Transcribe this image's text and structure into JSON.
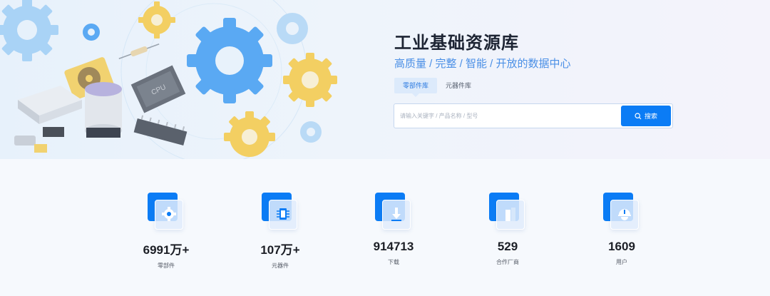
{
  "hero": {
    "title": "工业基础资源库",
    "subtitle": "高质量 / 完整 / 智能 / 开放的数据中心"
  },
  "tabs": [
    {
      "label": "零部件库",
      "active": true
    },
    {
      "label": "元器件库",
      "active": false
    }
  ],
  "search": {
    "placeholder": "请输入关键字 / 产品名称 / 型号",
    "button_label": "搜索",
    "button_icon": "search-icon"
  },
  "stats": [
    {
      "value": "6991万+",
      "label": "零部件",
      "icon": "gear-icon"
    },
    {
      "value": "107万+",
      "label": "元器件",
      "icon": "chip-icon"
    },
    {
      "value": "914713",
      "label": "下载",
      "icon": "download-icon"
    },
    {
      "value": "529",
      "label": "合作厂商",
      "icon": "building-icon"
    },
    {
      "value": "1609",
      "label": "用户",
      "icon": "user-helmet-icon"
    }
  ],
  "illustration": {
    "chip_label": "CPU"
  },
  "colors": {
    "accent": "#0b7cf5",
    "title": "#1d2433",
    "subtitle": "#4a8fe6"
  }
}
